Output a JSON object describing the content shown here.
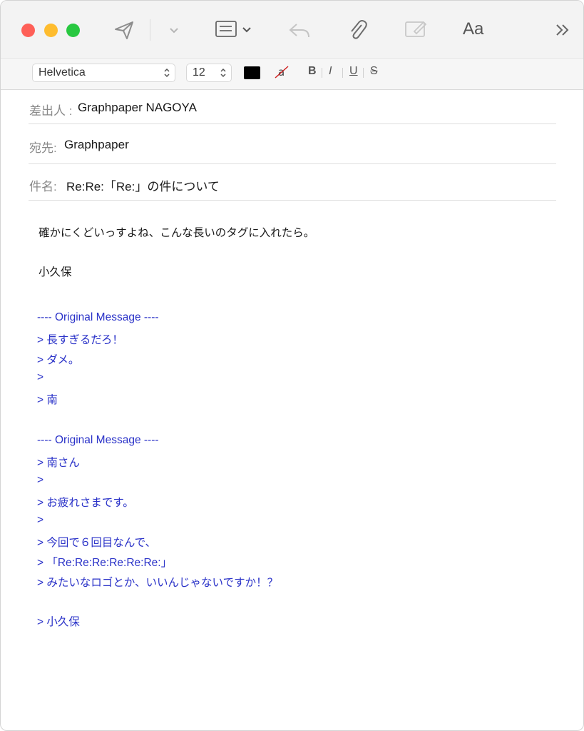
{
  "toolbar": {
    "send_icon": "send-icon",
    "font_panel_label": "Aa",
    "more_label": "»"
  },
  "format": {
    "font_family": "Helvetica",
    "font_size": "12",
    "text_color": "#000000",
    "bold": "B",
    "italic": "I",
    "underline": "U",
    "strikethrough": "S"
  },
  "header": {
    "from_label": "差出人 :",
    "from_value": "Graphpaper NAGOYA",
    "to_label": "宛先:",
    "to_value": "Graphpaper",
    "subject_label": "件名:",
    "subject_value": "Re:Re:「Re:」の件について"
  },
  "body": {
    "line1": "確かにくどいっすよね、こんな長いのタグに入れたら。",
    "signature": "小久保",
    "quote_block_1": [
      "---- Original Message ----",
      "> 長すぎるだろ！",
      "> ダメ。",
      ">",
      "> 南"
    ],
    "quote_block_2": [
      "---- Original Message ----",
      "> 南さん",
      ">",
      "> お疲れさまです。",
      ">",
      "> 今回で６回目なんで、",
      "> 「Re:Re:Re:Re:Re:Re:」",
      "> みたいなロゴとか、いいんじゃないですか！？",
      "",
      "> 小久保"
    ]
  },
  "colors": {
    "quote": "#2a32c8",
    "close": "#fe5f57",
    "minimize": "#febc2e",
    "zoom": "#28c840"
  }
}
